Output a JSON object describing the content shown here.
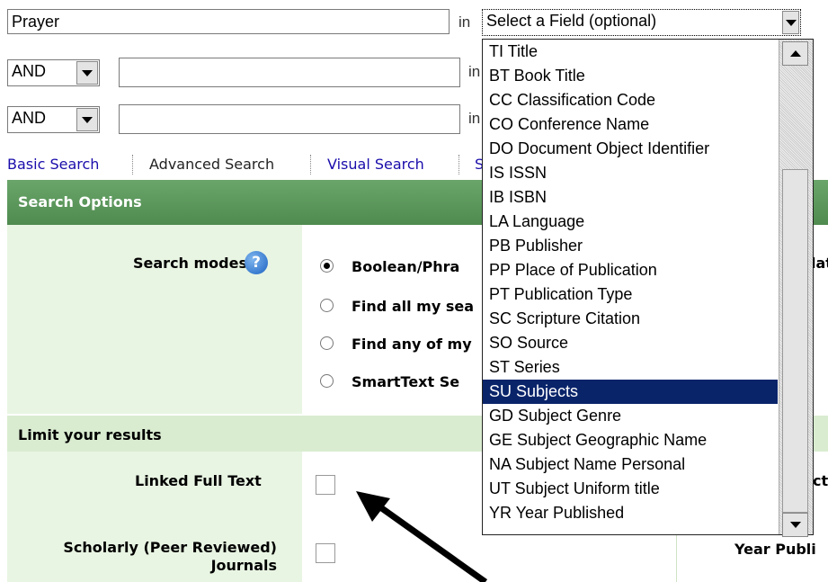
{
  "search": {
    "query1": "Prayer",
    "field1": "Select a Field (optional)",
    "in_label": "in",
    "row2_operator": "AND",
    "row3_operator": "AND"
  },
  "nav": {
    "basic": "Basic Search",
    "advanced": "Advanced Search",
    "visual": "Visual Search",
    "fourth_partial": "S"
  },
  "options": {
    "header": "Search Options",
    "modes_label": "Search modes",
    "help_glyph": "?",
    "modes": [
      "Boolean/Phra",
      "Find all my sea",
      "Find any of my",
      "SmartText Se"
    ],
    "right_partial": "lat"
  },
  "limits": {
    "header": "Limit your results",
    "linked_full_text": "Linked Full Text",
    "scholarly": "Scholarly (Peer Reviewed) Journals",
    "right_partial1": "ct",
    "year_published_partial": "Year Publi"
  },
  "dropdown": {
    "items": [
      "TI Title",
      "BT Book Title",
      "CC Classification Code",
      "CO Conference Name",
      "DO Document Object Identifier",
      "IS ISSN",
      "IB ISBN",
      "LA Language",
      "PB Publisher",
      "PP Place of Publication",
      "PT Publication Type",
      "SC Scripture Citation",
      "SO Source",
      "ST Series",
      "SU Subjects",
      "GD Subject Genre",
      "GE Subject Geographic Name",
      "NA Subject Name Personal",
      "UT Subject Uniform title",
      "YR Year Published"
    ],
    "selected_index": 14
  },
  "colors": {
    "link": "#1a0dab",
    "green": "#4f8a4f",
    "panel": "#e9f5e3",
    "selection": "#0a246a"
  }
}
